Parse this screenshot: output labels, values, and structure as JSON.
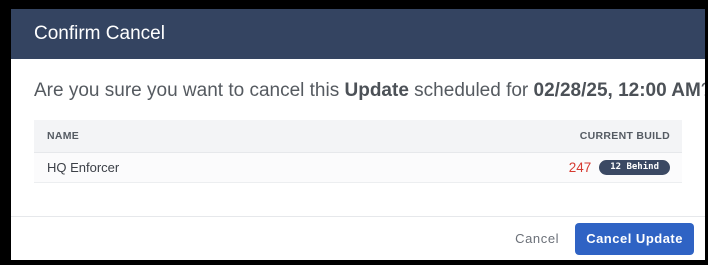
{
  "dialog": {
    "title": "Confirm Cancel",
    "question": {
      "prefix": "Are you sure you want to cancel this ",
      "item_type": "Update",
      "middle": " scheduled for ",
      "scheduled_time": "02/28/25, 12:00 AM",
      "suffix": "?"
    },
    "table": {
      "columns": [
        "NAME",
        "CURRENT BUILD"
      ],
      "rows": [
        {
          "name": "HQ Enforcer",
          "current_build": "247",
          "behind_badge": "12 Behind"
        }
      ]
    },
    "footer": {
      "cancel_label": "Cancel",
      "confirm_label": "Cancel Update"
    }
  },
  "colors": {
    "header_bg": "#344461",
    "primary_button": "#2f63c4",
    "build_number": "#d63a30",
    "badge_bg": "#3b4963"
  }
}
